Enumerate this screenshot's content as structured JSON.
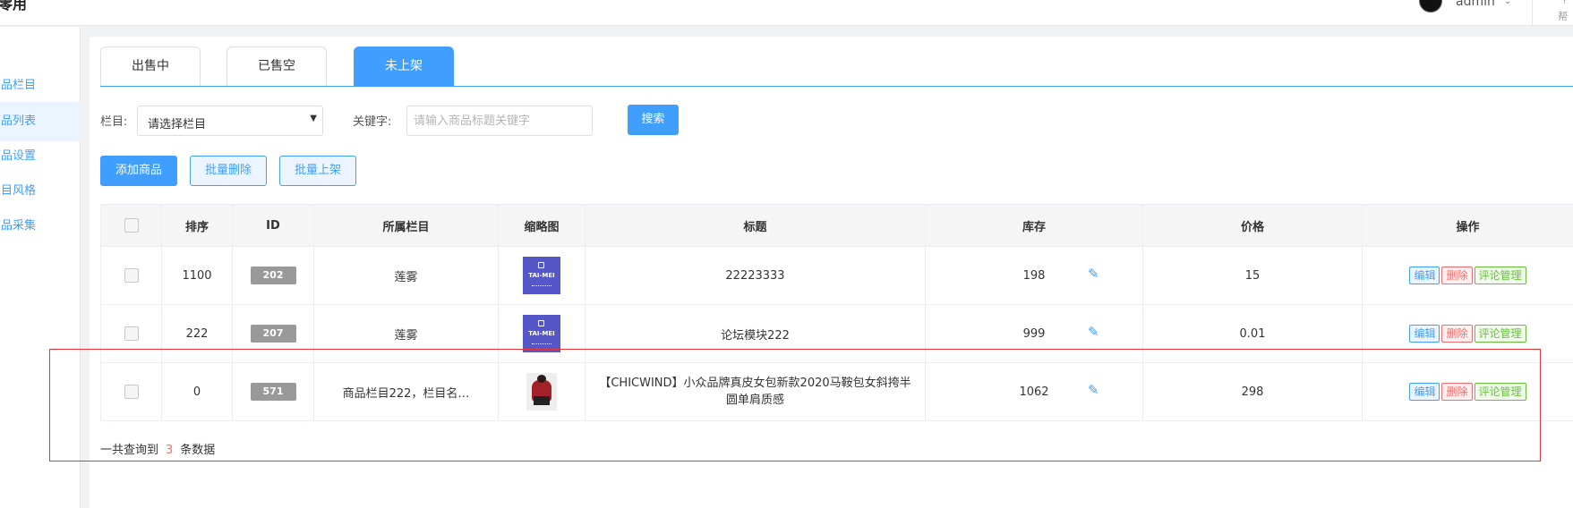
{
  "header": {
    "app_title": "零用",
    "user": "admin",
    "help": "帮"
  },
  "sidebar": {
    "items": [
      {
        "label": "商品栏目",
        "active": false
      },
      {
        "label": "商品列表",
        "active": true
      },
      {
        "label": "商品设置",
        "active": false
      },
      {
        "label": "栏目风格",
        "active": false
      },
      {
        "label": "商品采集",
        "active": false
      }
    ]
  },
  "tabs": [
    {
      "label": "出售中",
      "active": false
    },
    {
      "label": "已售空",
      "active": false
    },
    {
      "label": "未上架",
      "active": true
    }
  ],
  "filters": {
    "category_label": "栏目:",
    "category_value": "请选择栏目",
    "keyword_label": "关键字:",
    "keyword_placeholder": "请输入商品标题关键字",
    "search_button": "搜索"
  },
  "actions": {
    "add": "添加商品",
    "batch_delete": "批量删除",
    "batch_publish": "批量上架"
  },
  "table": {
    "headers": [
      "排序",
      "ID",
      "所属栏目",
      "缩略图",
      "标题",
      "库存",
      "价格",
      "操作"
    ],
    "thumb_text": "TAI-MEI",
    "rows": [
      {
        "sort": "1100",
        "id": "202",
        "category": "莲雾",
        "thumb": "logo",
        "title": "22223333",
        "stock": "198",
        "price": "15"
      },
      {
        "sort": "222",
        "id": "207",
        "category": "莲雾",
        "thumb": "logo",
        "title": "论坛模块222",
        "stock": "999",
        "price": "0.01"
      },
      {
        "sort": "0",
        "id": "571",
        "category": "商品栏目222，栏目名…",
        "thumb": "photo",
        "title": "【CHICWIND】小众品牌真皮女包新款2020马鞍包女斜挎半圆单肩质感",
        "stock": "1062",
        "price": "298"
      }
    ],
    "row_actions": {
      "edit": "编辑",
      "delete": "删除",
      "comments": "评论管理"
    }
  },
  "summary": {
    "prefix": "一共查询到",
    "count": "3",
    "suffix": "条数据"
  },
  "colors": {
    "primary": "#409eff",
    "danger": "#f56c6c",
    "success": "#67c23a"
  }
}
